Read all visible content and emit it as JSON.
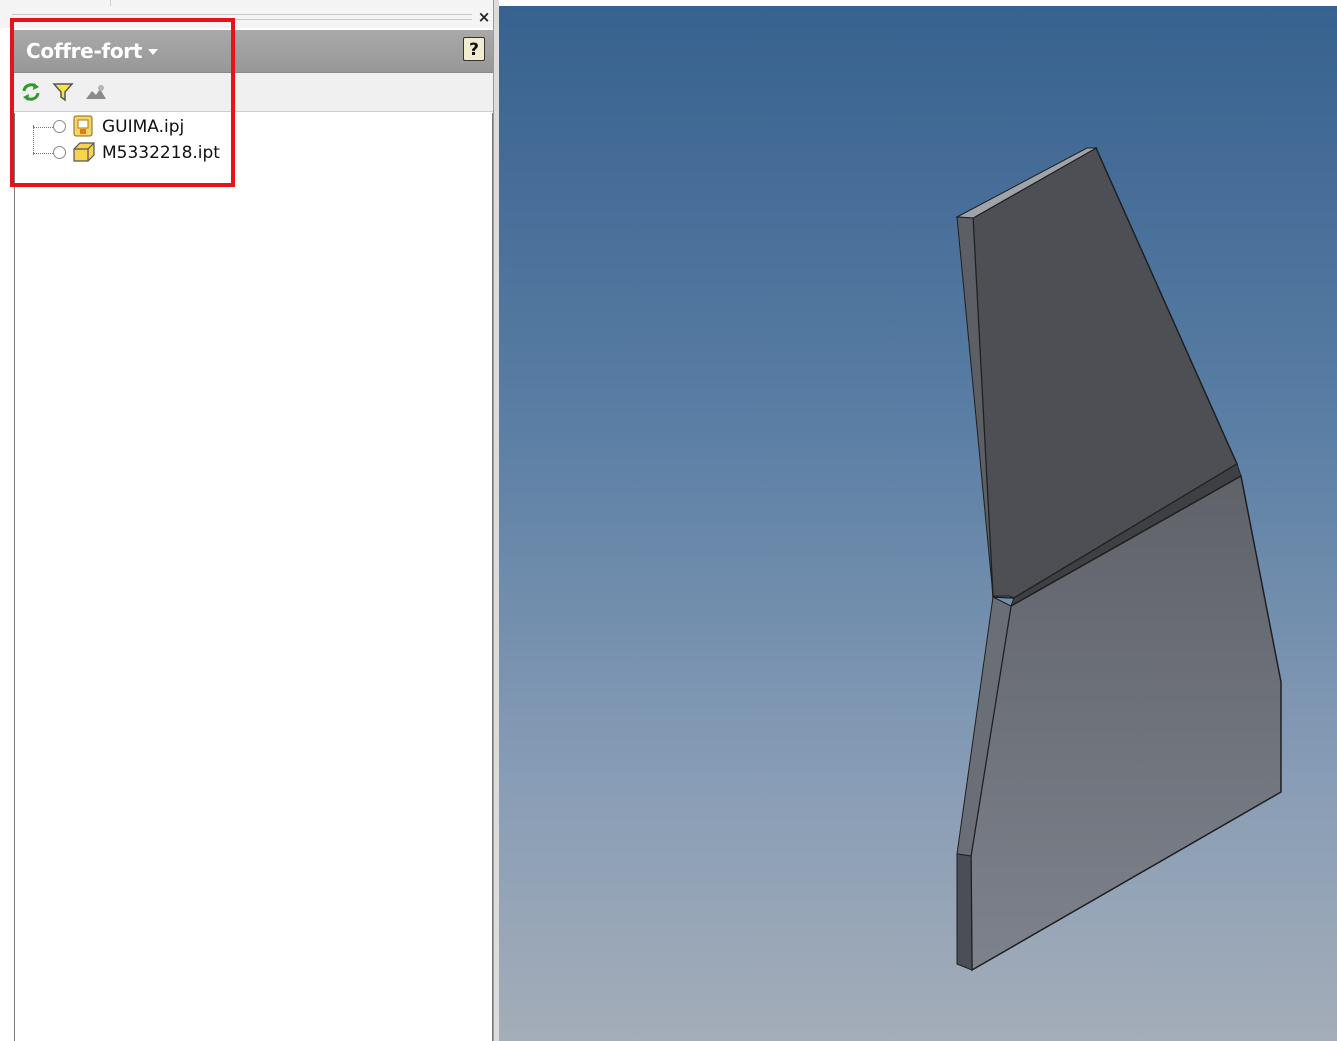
{
  "window": {
    "close_symbol": "×"
  },
  "browser": {
    "title": "Coffre-fort",
    "help_symbol": "?",
    "toolbar": [
      {
        "icon": "refresh-icon"
      },
      {
        "icon": "filter-icon"
      },
      {
        "icon": "vault-search-icon"
      }
    ],
    "items": [
      {
        "name": "GUIMA.ipj",
        "icon": "project-file-icon",
        "status": "unchecked"
      },
      {
        "name": "M5332218.ipt",
        "icon": "part-file-icon",
        "status": "unchecked"
      }
    ]
  },
  "colors": {
    "highlight": "#e8121a",
    "viewport_top": "#37618f",
    "viewport_bottom": "#a4adb8",
    "part_dark": "#4e5056",
    "part_light": "#6d737c"
  }
}
